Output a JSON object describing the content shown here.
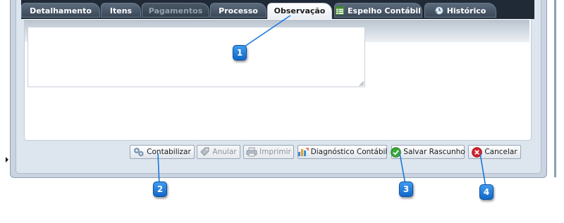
{
  "tabs": [
    {
      "label": "Detalhamento",
      "state": "normal"
    },
    {
      "label": "Itens",
      "state": "normal"
    },
    {
      "label": "Pagamentos",
      "state": "disabled"
    },
    {
      "label": "Processo",
      "state": "normal"
    },
    {
      "label": "Observação",
      "state": "active"
    },
    {
      "label": "Espelho Contábil",
      "state": "normal",
      "icon": "spreadsheet-icon"
    },
    {
      "label": "Histórico",
      "state": "normal",
      "icon": "history-icon"
    }
  ],
  "observacao": {
    "value": "",
    "placeholder": ""
  },
  "buttons": {
    "contabilizar": "Contabilizar",
    "anular": "Anular",
    "imprimir": "Imprimir",
    "diagnostico": "Diagnóstico Contábil",
    "salvar_rascunho": "Salvar Rascunho",
    "cancelar": "Cancelar"
  },
  "callouts": [
    "1",
    "2",
    "3",
    "4"
  ],
  "colors": {
    "tab_bar": "#1f2a36",
    "callout_blue": "#1a78e0",
    "panel_header": "#c4cdd8",
    "cancel_red": "#d9202a",
    "save_green": "#3aa83a"
  }
}
